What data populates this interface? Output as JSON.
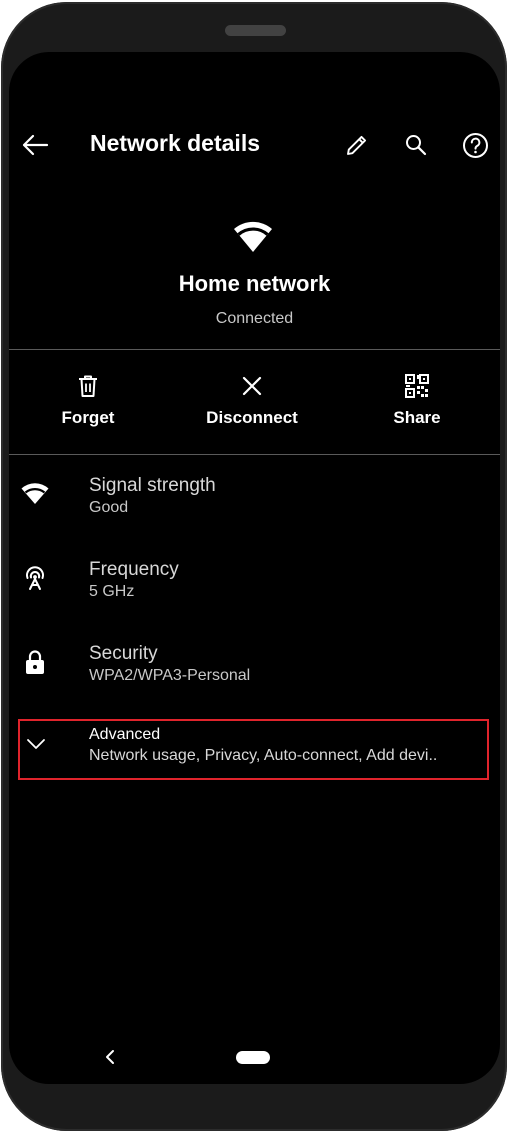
{
  "header": {
    "title": "Network details",
    "back_icon": "arrow-left-icon",
    "edit_icon": "pencil-icon",
    "search_icon": "search-icon",
    "help_icon": "help-circle-icon"
  },
  "network": {
    "icon": "wifi-icon",
    "name": "Home network",
    "status": "Connected"
  },
  "actions": [
    {
      "label": "Forget",
      "icon": "trash-icon"
    },
    {
      "label": "Disconnect",
      "icon": "close-icon"
    },
    {
      "label": "Share",
      "icon": "qr-code-icon"
    }
  ],
  "details": [
    {
      "title": "Signal strength",
      "value": "Good",
      "icon": "wifi-signal-icon"
    },
    {
      "title": "Frequency",
      "value": "5 GHz",
      "icon": "antenna-icon"
    },
    {
      "title": "Security",
      "value": "WPA2/WPA3-Personal",
      "icon": "lock-icon"
    }
  ],
  "advanced": {
    "title": "Advanced",
    "subtitle": "Network usage, Privacy, Auto-connect, Add devi..",
    "icon": "chevron-down-icon",
    "highlight_color": "#e0242c"
  },
  "nav": {
    "back_icon": "nav-back-icon",
    "home_icon": "home-pill-icon"
  }
}
